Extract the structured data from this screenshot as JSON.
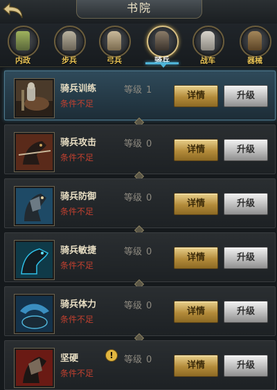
{
  "header": {
    "title": "书院"
  },
  "tabs": [
    {
      "label": "内政",
      "active": false
    },
    {
      "label": "步兵",
      "active": false
    },
    {
      "label": "弓兵",
      "active": false
    },
    {
      "label": "骑兵",
      "active": true
    },
    {
      "label": "战车",
      "active": false
    },
    {
      "label": "器械",
      "active": false
    }
  ],
  "techs": [
    {
      "name": "骑兵训练",
      "condition": "条件不足",
      "level_label": "等级",
      "level": "1",
      "detail_label": "详情",
      "upgrade_label": "升级",
      "warning": false
    },
    {
      "name": "骑兵攻击",
      "condition": "条件不足",
      "level_label": "等级",
      "level": "0",
      "detail_label": "详情",
      "upgrade_label": "升级",
      "warning": false
    },
    {
      "name": "骑兵防御",
      "condition": "条件不足",
      "level_label": "等级",
      "level": "0",
      "detail_label": "详情",
      "upgrade_label": "升级",
      "warning": false
    },
    {
      "name": "骑兵敏捷",
      "condition": "条件不足",
      "level_label": "等级",
      "level": "0",
      "detail_label": "详情",
      "upgrade_label": "升级",
      "warning": false
    },
    {
      "name": "骑兵体力",
      "condition": "条件不足",
      "level_label": "等级",
      "level": "0",
      "detail_label": "详情",
      "upgrade_label": "升级",
      "warning": false
    },
    {
      "name": "坚硬",
      "condition": "条件不足",
      "level_label": "等级",
      "level": "0",
      "detail_label": "详情",
      "upgrade_label": "升级",
      "warning": true,
      "warning_glyph": "!"
    }
  ],
  "colors": {
    "accent_gold": "#e7c255",
    "condition_red": "#c2402f",
    "selection_blue": "#4fb4d8"
  },
  "icons": {
    "back": "back-arrow-icon",
    "tab_icons": [
      "treasure-bowl-icon",
      "infantry-icon",
      "archer-icon",
      "cavalry-icon",
      "chariot-icon",
      "siege-icon"
    ],
    "tech_icons": [
      "cavalry-training-icon",
      "cavalry-attack-icon",
      "cavalry-defense-icon",
      "cavalry-agility-icon",
      "cavalry-stamina-icon",
      "hardness-icon"
    ]
  }
}
